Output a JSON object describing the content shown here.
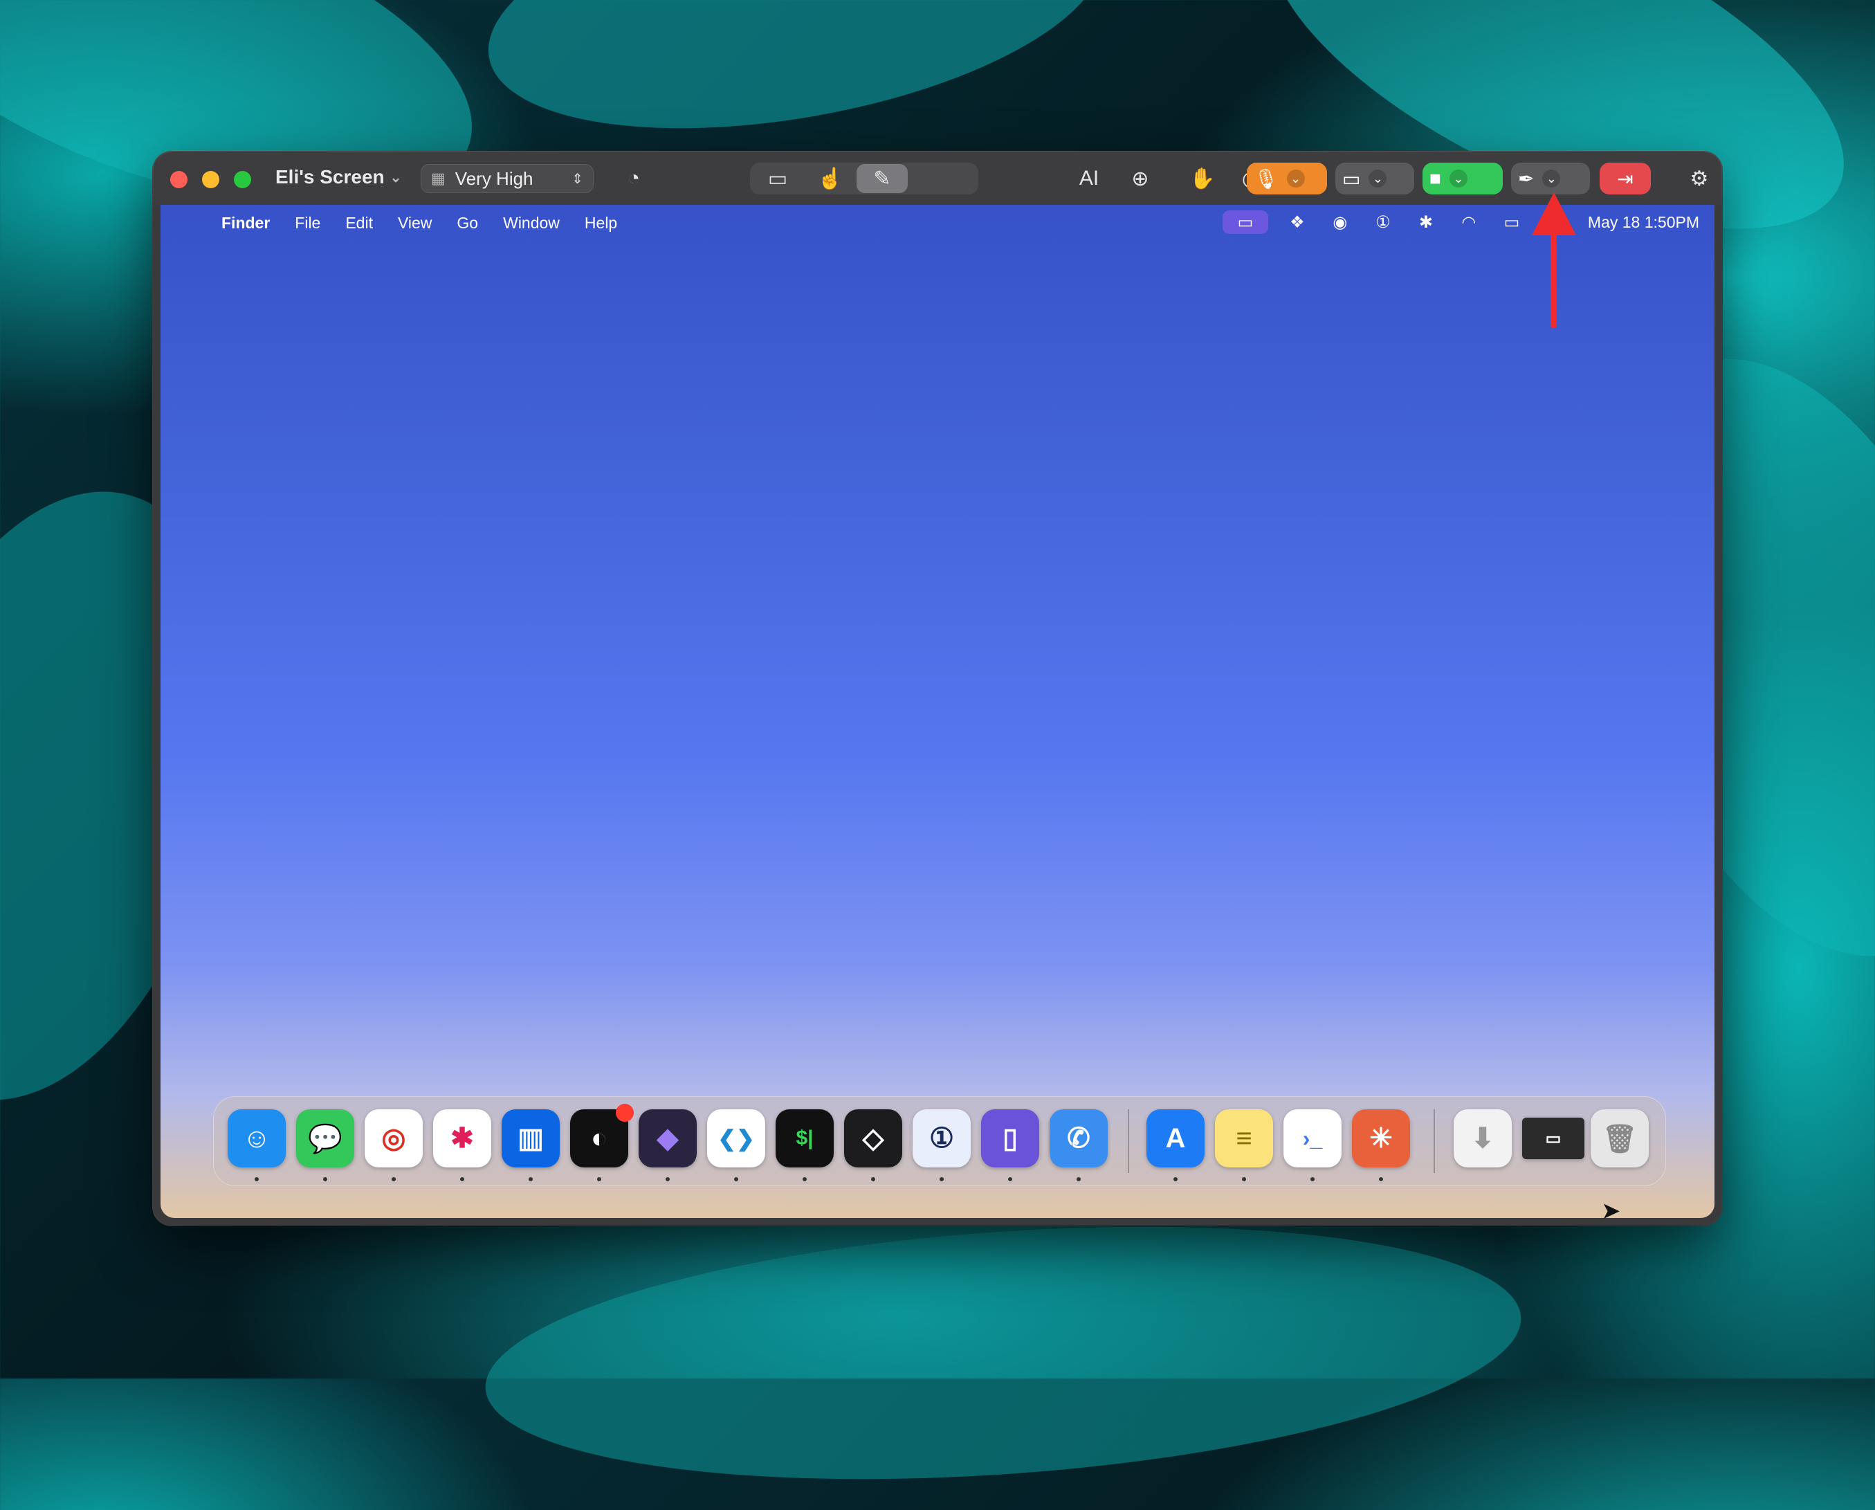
{
  "window": {
    "title": "Eli's Screen",
    "title_chevron": "⌄",
    "quality": {
      "value": "Very High"
    }
  },
  "toolbar_icons": {
    "quality_grid": "grid-icon",
    "speed": "gauge-icon",
    "screen_select": "screen-cursor-icon",
    "pointer": "hand-pointer-icon",
    "draw": "pen-scribble-icon",
    "text": "AI",
    "zoom": "zoom-in-icon",
    "wave": "wave-hand-icon",
    "remote": "remote-control-icon",
    "mic": "microphone-icon",
    "screen_share": "screen-share-icon",
    "camera": "video-camera-icon",
    "draw_pen": "feather-pen-icon",
    "leave": "leave-icon",
    "settings": "gear-icon"
  },
  "desktop": {
    "menubar": {
      "apple": "",
      "app_name": "Finder",
      "menus": [
        "File",
        "Edit",
        "View",
        "Go",
        "Window",
        "Help"
      ],
      "datetime": "May 18  1:50PM"
    }
  },
  "dock": {
    "apps": [
      {
        "name": "Finder",
        "color": "#1e8ef0",
        "glyph": "☺"
      },
      {
        "name": "Messages",
        "color": "#34c759",
        "glyph": "💬"
      },
      {
        "name": "Chrome",
        "color": "#ffffff",
        "glyph": "◎"
      },
      {
        "name": "Slack",
        "color": "#ffffff",
        "glyph": "✱"
      },
      {
        "name": "Trello",
        "color": "#0c66e4",
        "glyph": "▥"
      },
      {
        "name": "Linear",
        "color": "#111111",
        "glyph": "◐"
      },
      {
        "name": "Obsidian",
        "color": "#2a2440",
        "glyph": "◆"
      },
      {
        "name": "VS Code",
        "color": "#ffffff",
        "glyph": "❮❯"
      },
      {
        "name": "Terminal",
        "color": "#111111",
        "glyph": "$|"
      },
      {
        "name": "Layers",
        "color": "#1c1c1e",
        "glyph": "◇"
      },
      {
        "name": "1Password",
        "color": "#e8eefc",
        "glyph": "①"
      },
      {
        "name": "Notes App",
        "color": "#6a52d9",
        "glyph": "▯"
      },
      {
        "name": "Phone App",
        "color": "#3a8ef0",
        "glyph": "✆"
      },
      {
        "name": "App Store",
        "color": "#1d7bf5",
        "glyph": "A"
      },
      {
        "name": "Notes",
        "color": "#fbe27a",
        "glyph": "≡"
      },
      {
        "name": "Prompt",
        "color": "#3a78f0",
        "glyph": "›_"
      },
      {
        "name": "Claude",
        "color": "#e8613a",
        "glyph": "✳"
      },
      {
        "name": "Downloads",
        "color": "#f2f2f2",
        "glyph": "⬇"
      },
      {
        "name": "Screenshot",
        "color": "#2b2b2b",
        "glyph": "▭"
      },
      {
        "name": "Trash",
        "color": "#e6e6e6",
        "glyph": "🗑"
      }
    ]
  },
  "colors": {
    "arrow": "#ef2b2d",
    "mic": "#f0892a",
    "camera": "#34c759",
    "leave": "#e5484d"
  }
}
